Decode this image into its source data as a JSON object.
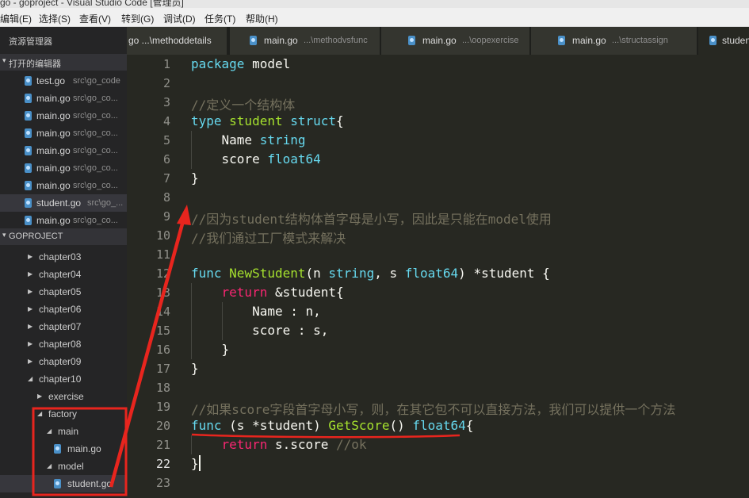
{
  "window": {
    "title": "go - goproject - Visual Studio Code [管理员]"
  },
  "menu": [
    {
      "label": "编辑(E)"
    },
    {
      "label": "选择(S)"
    },
    {
      "label": "查看(V)"
    },
    {
      "label": "转到(G)"
    },
    {
      "label": "调试(D)"
    },
    {
      "label": "任务(T)"
    },
    {
      "label": "帮助(H)"
    }
  ],
  "sidebar": {
    "title": "资源管理器",
    "open_editors": {
      "label": "打开的编辑器",
      "items": [
        {
          "name": "test.go",
          "path": "src\\go_code"
        },
        {
          "name": "main.go",
          "path": "src\\go_co..."
        },
        {
          "name": "main.go",
          "path": "src\\go_co..."
        },
        {
          "name": "main.go",
          "path": "src\\go_co..."
        },
        {
          "name": "main.go",
          "path": "src\\go_co..."
        },
        {
          "name": "main.go",
          "path": "src\\go_co..."
        },
        {
          "name": "main.go",
          "path": "src\\go_co..."
        },
        {
          "name": "student.go",
          "path": "src\\go_..."
        },
        {
          "name": "main.go",
          "path": "src\\go_co..."
        }
      ]
    },
    "project": {
      "label": "GOPROJECT",
      "tree": [
        {
          "name": "chapter03",
          "expanded": false
        },
        {
          "name": "chapter04",
          "expanded": false
        },
        {
          "name": "chapter05",
          "expanded": false
        },
        {
          "name": "chapter06",
          "expanded": false
        },
        {
          "name": "chapter07",
          "expanded": false
        },
        {
          "name": "chapter08",
          "expanded": false
        },
        {
          "name": "chapter09",
          "expanded": false
        },
        {
          "name": "chapter10",
          "expanded": true
        },
        {
          "name": "exercise",
          "expanded": false
        },
        {
          "name": "factory",
          "expanded": true
        },
        {
          "name": "main",
          "expanded": true
        },
        {
          "name": "main.go",
          "file": true
        },
        {
          "name": "model",
          "expanded": true
        },
        {
          "name": "student.go",
          "file": true
        }
      ]
    }
  },
  "tabs": [
    {
      "name": "main.go",
      "path": "...\\methoddetails",
      "display": "go ...\\methoddetails"
    },
    {
      "name": "main.go",
      "path": "...\\methodvsfunc"
    },
    {
      "name": "main.go",
      "path": "...\\oopexercise"
    },
    {
      "name": "main.go",
      "path": "...\\structassign"
    },
    {
      "name": "student.go",
      "display": "studen"
    }
  ],
  "editor": {
    "current_line": "22",
    "lines": [
      {
        "n": "1",
        "tokens": [
          {
            "t": "package",
            "c": "#66d9ef"
          },
          {
            "t": " model",
            "c": "#f8f8f2"
          }
        ]
      },
      {
        "n": "2",
        "tokens": []
      },
      {
        "n": "3",
        "tokens": [
          {
            "t": "//定义一个结构体",
            "c": "#75715e"
          }
        ]
      },
      {
        "n": "4",
        "tokens": [
          {
            "t": "type",
            "c": "#66d9ef"
          },
          {
            "t": " student",
            "c": "#a6e22e"
          },
          {
            "t": " ",
            "c": "#f8f8f2"
          },
          {
            "t": "struct",
            "c": "#66d9ef"
          },
          {
            "t": "{",
            "c": "#f8f8f2"
          }
        ]
      },
      {
        "n": "5",
        "tokens": [
          {
            "t": "    Name ",
            "c": "#f8f8f2"
          },
          {
            "t": "string",
            "c": "#66d9ef"
          }
        ]
      },
      {
        "n": "6",
        "tokens": [
          {
            "t": "    score ",
            "c": "#f8f8f2"
          },
          {
            "t": "float64",
            "c": "#66d9ef"
          }
        ]
      },
      {
        "n": "7",
        "tokens": [
          {
            "t": "}",
            "c": "#f8f8f2"
          }
        ]
      },
      {
        "n": "8",
        "tokens": []
      },
      {
        "n": "9",
        "tokens": [
          {
            "t": "//因为student结构体首字母是小写，因此是只能在model使用",
            "c": "#75715e"
          }
        ]
      },
      {
        "n": "10",
        "tokens": [
          {
            "t": "//我们通过工厂模式来解决",
            "c": "#75715e"
          }
        ]
      },
      {
        "n": "11",
        "tokens": []
      },
      {
        "n": "12",
        "tokens": [
          {
            "t": "func",
            "c": "#66d9ef"
          },
          {
            "t": " ",
            "c": "#f8f8f2"
          },
          {
            "t": "NewStudent",
            "c": "#a6e22e"
          },
          {
            "t": "(n ",
            "c": "#f8f8f2"
          },
          {
            "t": "string",
            "c": "#66d9ef"
          },
          {
            "t": ", s ",
            "c": "#f8f8f2"
          },
          {
            "t": "float64",
            "c": "#66d9ef"
          },
          {
            "t": ") *student {",
            "c": "#f8f8f2"
          }
        ]
      },
      {
        "n": "13",
        "tokens": [
          {
            "t": "    ",
            "c": "#f8f8f2"
          },
          {
            "t": "return",
            "c": "#f92672"
          },
          {
            "t": " &student{",
            "c": "#f8f8f2"
          }
        ]
      },
      {
        "n": "14",
        "tokens": [
          {
            "t": "        Name : n,",
            "c": "#f8f8f2"
          }
        ]
      },
      {
        "n": "15",
        "tokens": [
          {
            "t": "        score : s,",
            "c": "#f8f8f2"
          }
        ]
      },
      {
        "n": "16",
        "tokens": [
          {
            "t": "    }",
            "c": "#f8f8f2"
          }
        ]
      },
      {
        "n": "17",
        "tokens": [
          {
            "t": "}",
            "c": "#f8f8f2"
          }
        ]
      },
      {
        "n": "18",
        "tokens": []
      },
      {
        "n": "19",
        "tokens": [
          {
            "t": "//如果score字段首字母小写，则，在其它包不可以直接方法，我们可以提供一个方法",
            "c": "#75715e"
          }
        ]
      },
      {
        "n": "20",
        "tokens": [
          {
            "t": "func",
            "c": "#66d9ef"
          },
          {
            "t": " (s *student) ",
            "c": "#f8f8f2"
          },
          {
            "t": "GetScore",
            "c": "#a6e22e"
          },
          {
            "t": "() ",
            "c": "#f8f8f2"
          },
          {
            "t": "float64",
            "c": "#66d9ef"
          },
          {
            "t": "{",
            "c": "#f8f8f2"
          }
        ]
      },
      {
        "n": "21",
        "tokens": [
          {
            "t": "    ",
            "c": "#f8f8f2"
          },
          {
            "t": "return",
            "c": "#f92672"
          },
          {
            "t": " s.score ",
            "c": "#f8f8f2"
          },
          {
            "t": "//ok",
            "c": "#75715e"
          }
        ]
      },
      {
        "n": "22",
        "tokens": [
          {
            "t": "}",
            "c": "#f8f8f2"
          }
        ]
      },
      {
        "n": "23",
        "tokens": []
      }
    ]
  },
  "colors": {
    "annotation": "#e8251e",
    "accent": "#4a90c8"
  }
}
